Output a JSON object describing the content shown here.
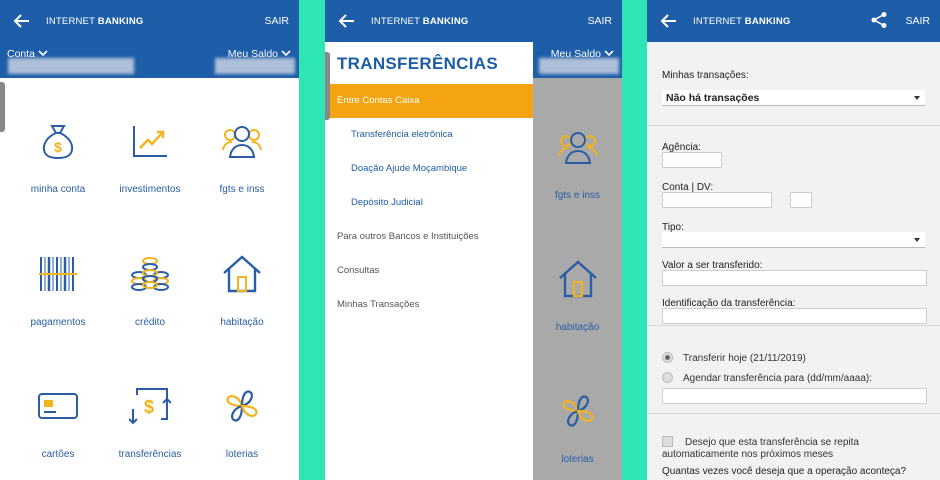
{
  "colors": {
    "header_blue": "#1e5da8",
    "accent_orange": "#f4a410",
    "icon_blue": "#2a5da6",
    "icon_gold": "#f4b21c",
    "separator_green": "#2ee6b5"
  },
  "panel1": {
    "header": {
      "title_prefix": "INTERNET ",
      "title_bold": "BANKING",
      "exit": "SAIR"
    },
    "subbar": {
      "conta": "Conta",
      "saldo": "Meu Saldo"
    },
    "tiles": [
      {
        "label": "minha conta",
        "icon": "money-bag-icon"
      },
      {
        "label": "investimentos",
        "icon": "growth-chart-icon"
      },
      {
        "label": "fgts e inss",
        "icon": "people-icon"
      },
      {
        "label": "pagamentos",
        "icon": "barcode-icon"
      },
      {
        "label": "crédito",
        "icon": "coins-icon"
      },
      {
        "label": "habitação",
        "icon": "house-icon"
      },
      {
        "label": "cartões",
        "icon": "card-icon"
      },
      {
        "label": "transferências",
        "icon": "transfer-icon"
      },
      {
        "label": "loterias",
        "icon": "clover-icon"
      }
    ]
  },
  "panel2": {
    "header": {
      "title_prefix": "INTERNET ",
      "title_bold": "BANKING",
      "exit": "SAIR"
    },
    "subbar": {
      "saldo": "Meu Saldo"
    },
    "drawer_title": "TRANSFERÊNCIAS",
    "menu": [
      {
        "label": "Entre Contas Caixa",
        "active": true,
        "sub": false
      },
      {
        "label": "Transferência eletrônica",
        "active": false,
        "sub": true
      },
      {
        "label": "Doação Ajude Moçambique",
        "active": false,
        "sub": true
      },
      {
        "label": "Depósito Judicial",
        "active": false,
        "sub": true
      },
      {
        "label": "Para outros Bancos e Instituições",
        "active": false,
        "sub": false
      },
      {
        "label": "Consultas",
        "active": false,
        "sub": false
      },
      {
        "label": "Minhas Transações",
        "active": false,
        "sub": false
      }
    ],
    "ghost_labels": {
      "fgts": "fgts e inss",
      "habitacao": "habitação",
      "loterias": "loterias"
    }
  },
  "panel3": {
    "header": {
      "title_prefix": "INTERNET ",
      "title_bold": "BANKING",
      "exit": "SAIR"
    },
    "minhas_transacoes_label": "Minhas transações:",
    "minhas_transacoes_value": "Não há transações",
    "agencia_label": "Agência:",
    "conta_dv_label": "Conta | DV:",
    "tipo_label": "Tipo:",
    "valor_label": "Valor a ser transferido:",
    "identificacao_label": "Identificação da transferência:",
    "radio_hoje": "Transferir hoje (21/11/2019)",
    "radio_agendar": "Agendar transferência para (dd/mm/aaaa):",
    "checkbox_repetir_1": "Desejo que esta transferência se repita",
    "checkbox_repetir_2": "automaticamente nos próximos meses",
    "quantas_vezes": "Quantas vezes você deseja que a operação aconteça?"
  }
}
